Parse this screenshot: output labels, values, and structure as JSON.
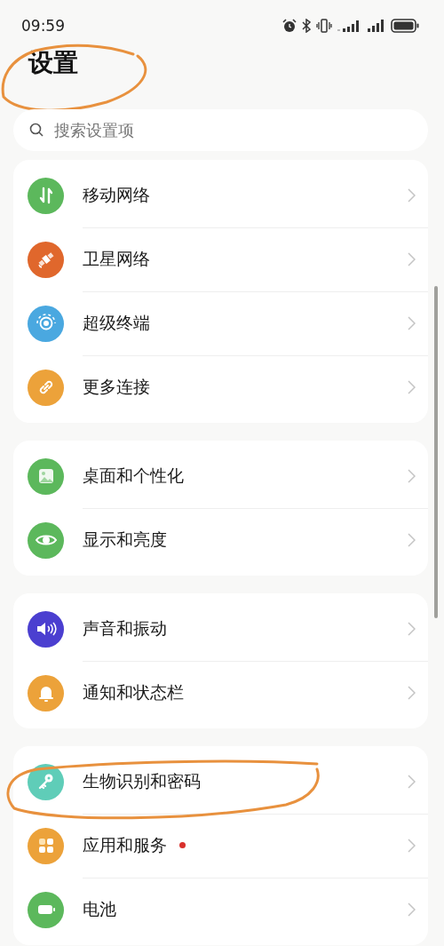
{
  "status_bar": {
    "time": "09:59"
  },
  "title": {
    "text": "设置",
    "circled": true
  },
  "search": {
    "placeholder": "搜索设置项"
  },
  "groups": [
    {
      "items": [
        {
          "label": "移动网络",
          "color": "#5cb85c",
          "dot": false,
          "circled": false
        },
        {
          "label": "卫星网络",
          "color": "#e0672c",
          "dot": false,
          "circled": false
        },
        {
          "label": "超级终端",
          "color": "#4aa8e0",
          "dot": false,
          "circled": false
        },
        {
          "label": "更多连接",
          "color": "#eca23a",
          "dot": false,
          "circled": false
        }
      ]
    },
    {
      "items": [
        {
          "label": "桌面和个性化",
          "color": "#5cb85c",
          "dot": false,
          "circled": false
        },
        {
          "label": "显示和亮度",
          "color": "#5cb85c",
          "dot": false,
          "circled": false
        }
      ]
    },
    {
      "items": [
        {
          "label": "声音和振动",
          "color": "#4b3fd0",
          "dot": false,
          "circled": false
        },
        {
          "label": "通知和状态栏",
          "color": "#eca23a",
          "dot": false,
          "circled": false
        }
      ]
    },
    {
      "items": [
        {
          "label": "生物识别和密码",
          "color": "#5fcdb8",
          "dot": false,
          "circled": true
        },
        {
          "label": "应用和服务",
          "color": "#eca23a",
          "dot": true,
          "circled": false
        },
        {
          "label": "电池",
          "color": "#5cb85c",
          "dot": false,
          "circled": false
        }
      ]
    }
  ]
}
